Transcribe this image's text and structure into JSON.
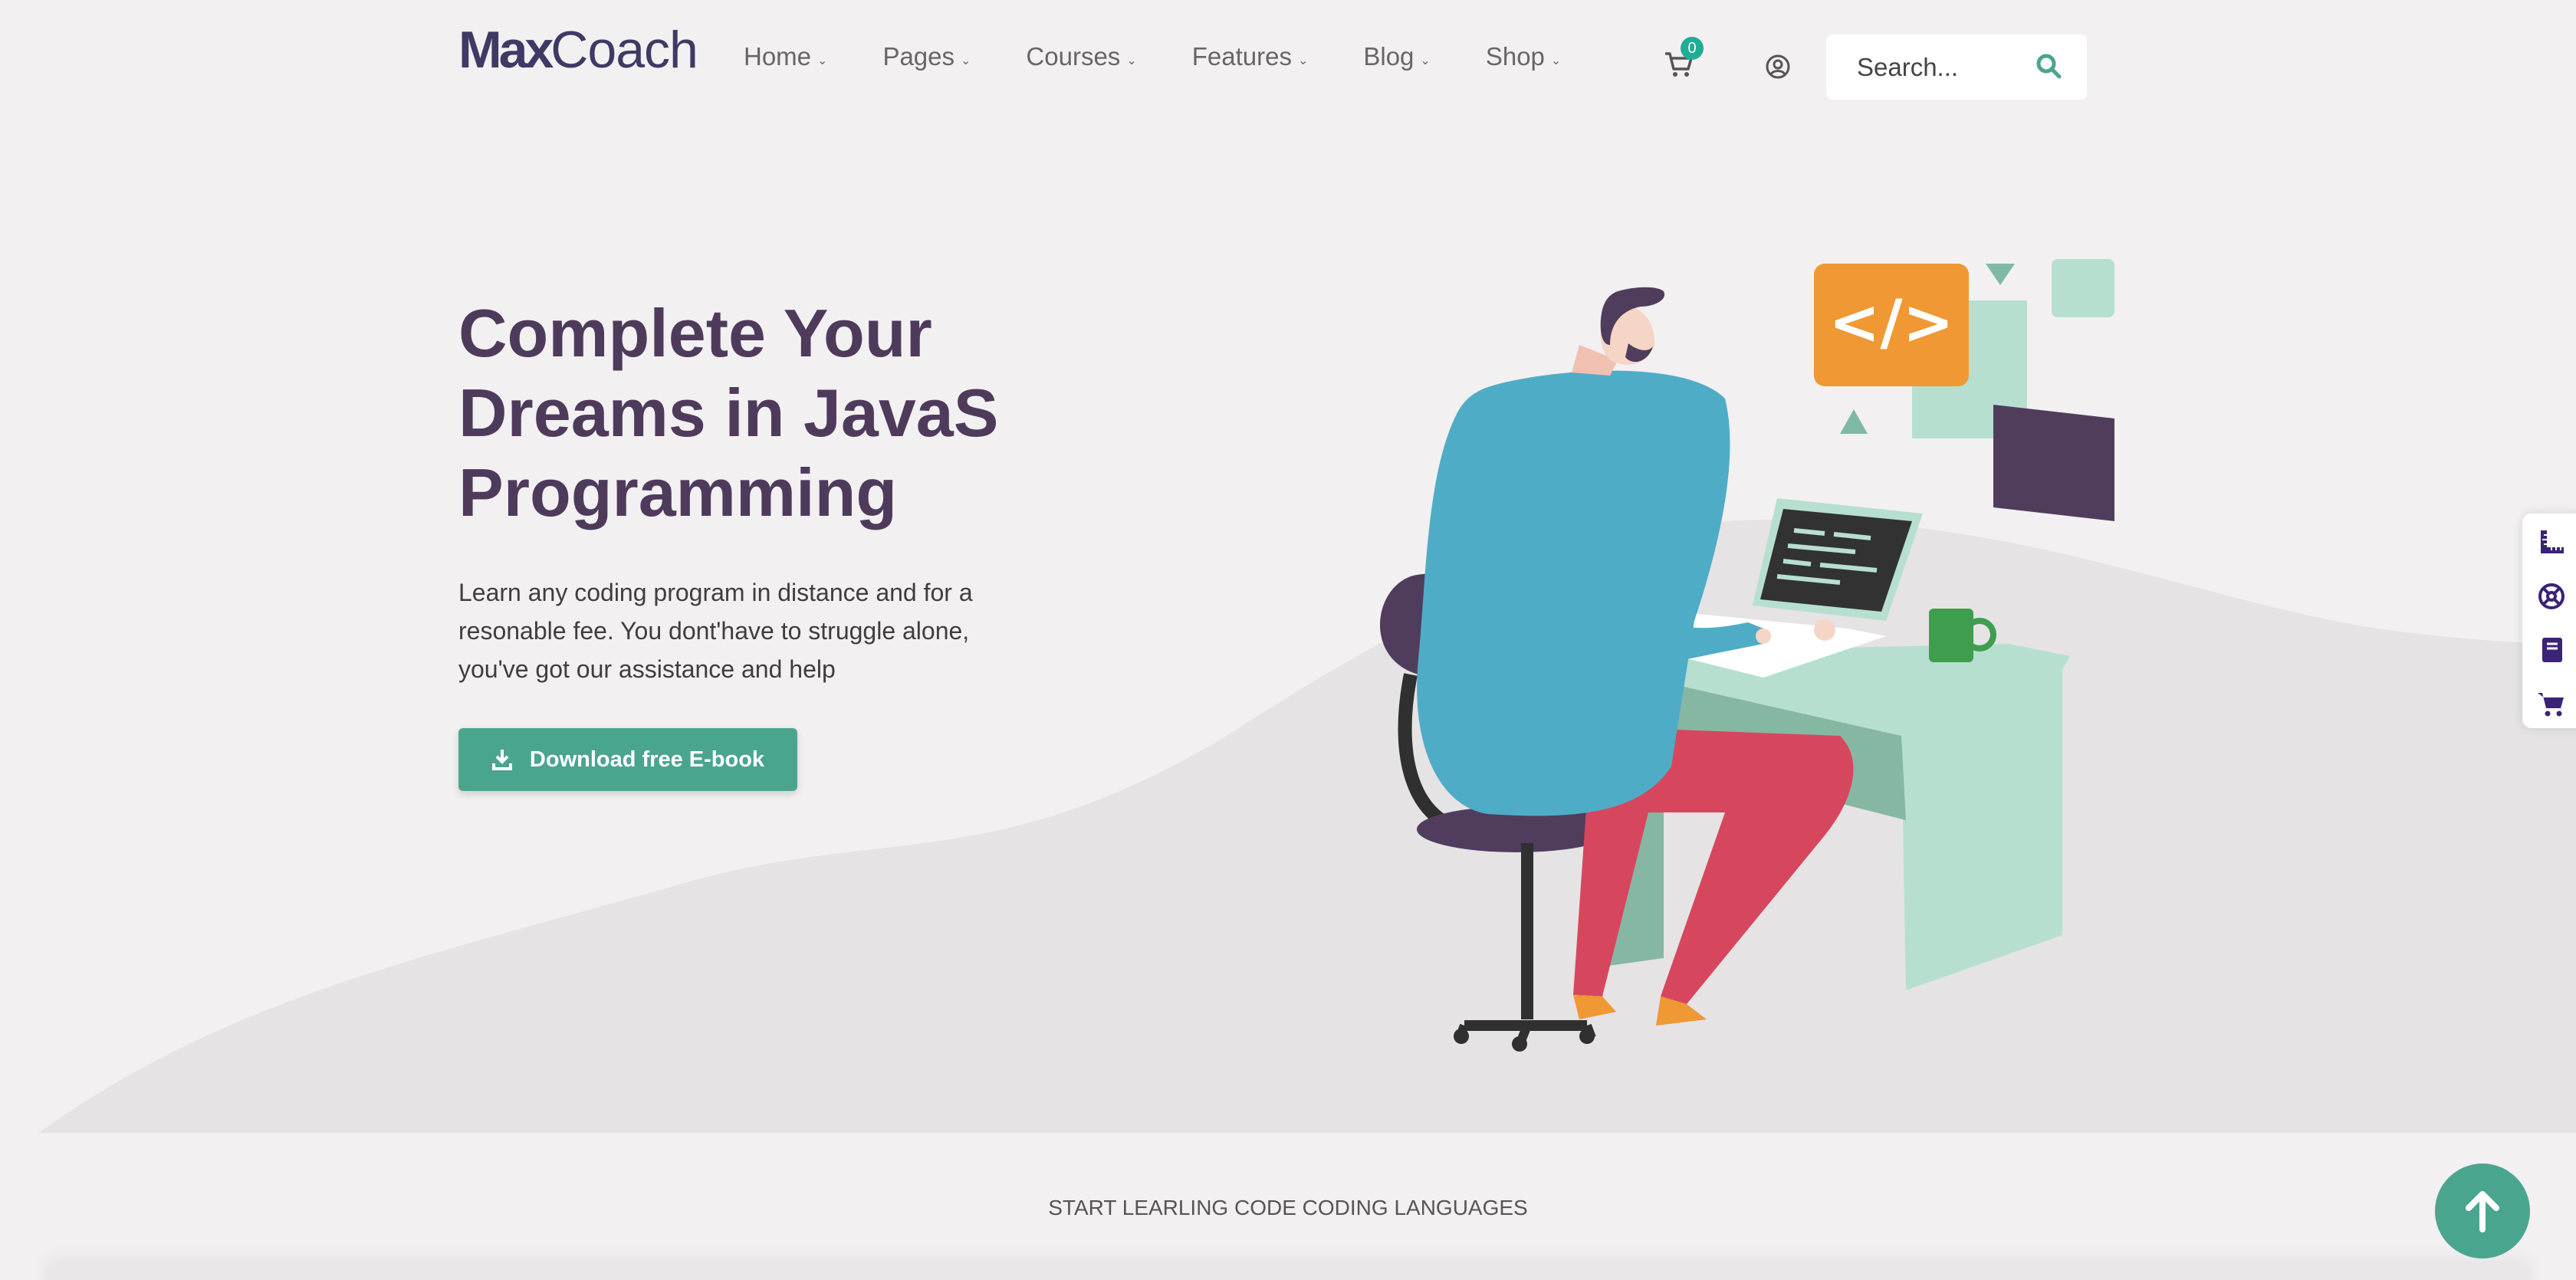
{
  "logo": {
    "bold": "Max",
    "regular": "Coach"
  },
  "nav": [
    {
      "label": "Home"
    },
    {
      "label": "Pages"
    },
    {
      "label": "Courses"
    },
    {
      "label": "Features"
    },
    {
      "label": "Blog"
    },
    {
      "label": "Shop"
    }
  ],
  "cart": {
    "count": "0"
  },
  "search": {
    "placeholder": "Search..."
  },
  "hero": {
    "title": "Complete Your Dreams in JavaS Programming",
    "description": "Learn any coding program in distance and for a resonable fee. You dont'have to struggle alone, you've got our assistance and help",
    "cta_label": "Download free E-book"
  },
  "illustration": {
    "code_badge": "</>"
  },
  "section": {
    "label": "START LEARLING CODE CODING LANGUAGES"
  },
  "colors": {
    "accent": "#4aa58f",
    "heading": "#4e3b5c",
    "orange": "#ef9834",
    "blue": "#4facc7",
    "pink": "#d6475e",
    "mint": "#b8dfcf"
  },
  "icons": [
    "cart-icon",
    "account-icon",
    "search-icon",
    "ruler-icon",
    "support-icon",
    "book-icon",
    "shopping-cart-icon",
    "arrow-up-icon",
    "download-icon"
  ]
}
